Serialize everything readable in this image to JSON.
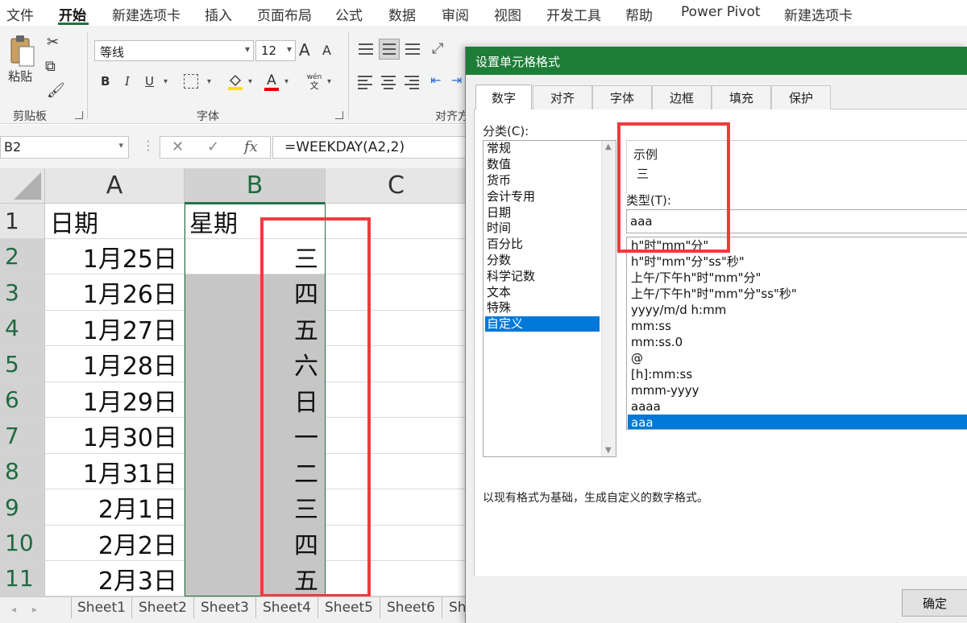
{
  "ribbon": {
    "tabs": [
      "文件",
      "开始",
      "新建选项卡",
      "插入",
      "页面布局",
      "公式",
      "数据",
      "审阅",
      "视图",
      "开发工具",
      "帮助",
      "Power Pivot",
      "新建选项卡"
    ],
    "active_tab": "开始",
    "paste_label": "粘贴",
    "font_name": "等线",
    "font_size": "12",
    "grow_font": "A",
    "shrink_font": "A",
    "bold": "B",
    "italic": "I",
    "underline": "U",
    "font_color": "A",
    "phonetic_top": "wén",
    "phonetic_bottom": "文",
    "groups": {
      "clipboard": "剪贴板",
      "font": "字体",
      "alignment": "对齐方"
    }
  },
  "formula_bar": {
    "name_box": "B2",
    "cancel": "✕",
    "enter": "✓",
    "fx": "fx",
    "formula": "=WEEKDAY(A2,2)"
  },
  "sheet": {
    "columns": [
      "A",
      "B",
      "C"
    ],
    "rows": [
      {
        "num": "1",
        "a": "日期",
        "b": "星期"
      },
      {
        "num": "2",
        "a": "1月25日",
        "b": "三"
      },
      {
        "num": "3",
        "a": "1月26日",
        "b": "四"
      },
      {
        "num": "4",
        "a": "1月27日",
        "b": "五"
      },
      {
        "num": "5",
        "a": "1月28日",
        "b": "六"
      },
      {
        "num": "6",
        "a": "1月29日",
        "b": "日"
      },
      {
        "num": "7",
        "a": "1月30日",
        "b": "一"
      },
      {
        "num": "8",
        "a": "1月31日",
        "b": "二"
      },
      {
        "num": "9",
        "a": "2月1日",
        "b": "三"
      },
      {
        "num": "10",
        "a": "2月2日",
        "b": "四"
      },
      {
        "num": "11",
        "a": "2月3日",
        "b": "五"
      }
    ],
    "tabs": [
      "Sheet1",
      "Sheet2",
      "Sheet3",
      "Sheet4",
      "Sheet5",
      "Sheet6",
      "Sh"
    ]
  },
  "dialog": {
    "title": "设置单元格格式",
    "tabs": [
      "数字",
      "对齐",
      "字体",
      "边框",
      "填充",
      "保护"
    ],
    "active_tab": "数字",
    "category_label": "分类(C):",
    "categories": [
      "常规",
      "数值",
      "货币",
      "会计专用",
      "日期",
      "时间",
      "百分比",
      "分数",
      "科学记数",
      "文本",
      "特殊",
      "自定义"
    ],
    "selected_category": "自定义",
    "sample_label": "示例",
    "sample_value": "三",
    "type_label": "类型(T):",
    "type_value": "aaa",
    "formats": [
      "h\"时\"mm\"分\"",
      "h\"时\"mm\"分\"ss\"秒\"",
      "上午/下午h\"时\"mm\"分\"",
      "上午/下午h\"时\"mm\"分\"ss\"秒\"",
      "yyyy/m/d h:mm",
      "mm:ss",
      "mm:ss.0",
      "@",
      "[h]:mm:ss",
      "mmm-yyyy",
      "aaaa",
      "aaa"
    ],
    "selected_format": "aaa",
    "description": "以现有格式为基础，生成自定义的数字格式。",
    "ok_label": "确定"
  },
  "colors": {
    "excel_green": "#217346",
    "dialog_title_green": "#1e7d37",
    "selection_blue": "#0078d7",
    "annotation_red": "#ef3b3f",
    "selected_fill_gray": "#c6c6c6"
  }
}
